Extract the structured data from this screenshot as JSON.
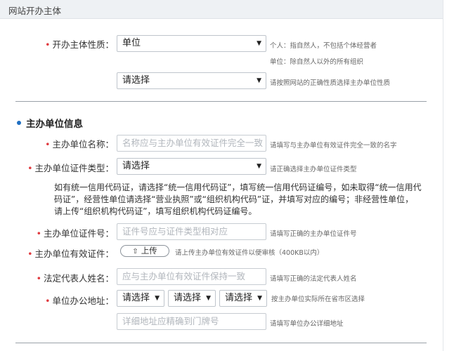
{
  "header": {
    "title": "网站开办主体"
  },
  "host_nature": {
    "label": "开办主体性质：",
    "select1_value": "单位",
    "hint_line1": "个人：指自然人，不包括个体经营者",
    "hint_line2": "单位：除自然人以外的所有组织",
    "select2_value": "请选择",
    "select2_hint": "请按照网站的正确性质选择主办单位性质"
  },
  "section": {
    "title": "主办单位信息"
  },
  "unit_name": {
    "label": "主办单位名称：",
    "placeholder": "名称应与主办单位有效证件完全一致",
    "hint": "请填写与主办单位有效证件完全一致的名字"
  },
  "cert_type": {
    "label": "主办单位证件类型：",
    "select_value": "请选择",
    "hint": "请正确选择主办单位证件类型"
  },
  "note": "如有统一信用代码证，请选择“统一信用代码证”，填写统一信用代码证编号，如未取得“统一信用代码证”，经营性单位请选择“营业执照”或“组织机构代码”证，并填写对应的编号；非经营性单位，请上传“组织机构代码证”，填写组织机构代码证编号。",
  "cert_number": {
    "label": "主办单位证件号：",
    "placeholder": "证件号应与证件类型相对应",
    "hint": "请填写正确的主办单位证件号"
  },
  "cert_upload": {
    "label": "主办单位有效证件：",
    "button_label": "上传",
    "hint": "请上传主办单位有效证件以便审核（400KB以内）"
  },
  "legal_rep": {
    "label": "法定代表人姓名：",
    "placeholder": "应与主办单位有效证件保持一致",
    "hint": "请填写正确的法定代表人姓名"
  },
  "address": {
    "label": "单位办公地址：",
    "province": "请选择",
    "city": "请选择",
    "district": "请选择",
    "region_hint": "按主办单位实际所在省市区选择",
    "detail_placeholder": "详细地址应精确到门牌号",
    "detail_hint": "请填写单位办公详细地址"
  }
}
